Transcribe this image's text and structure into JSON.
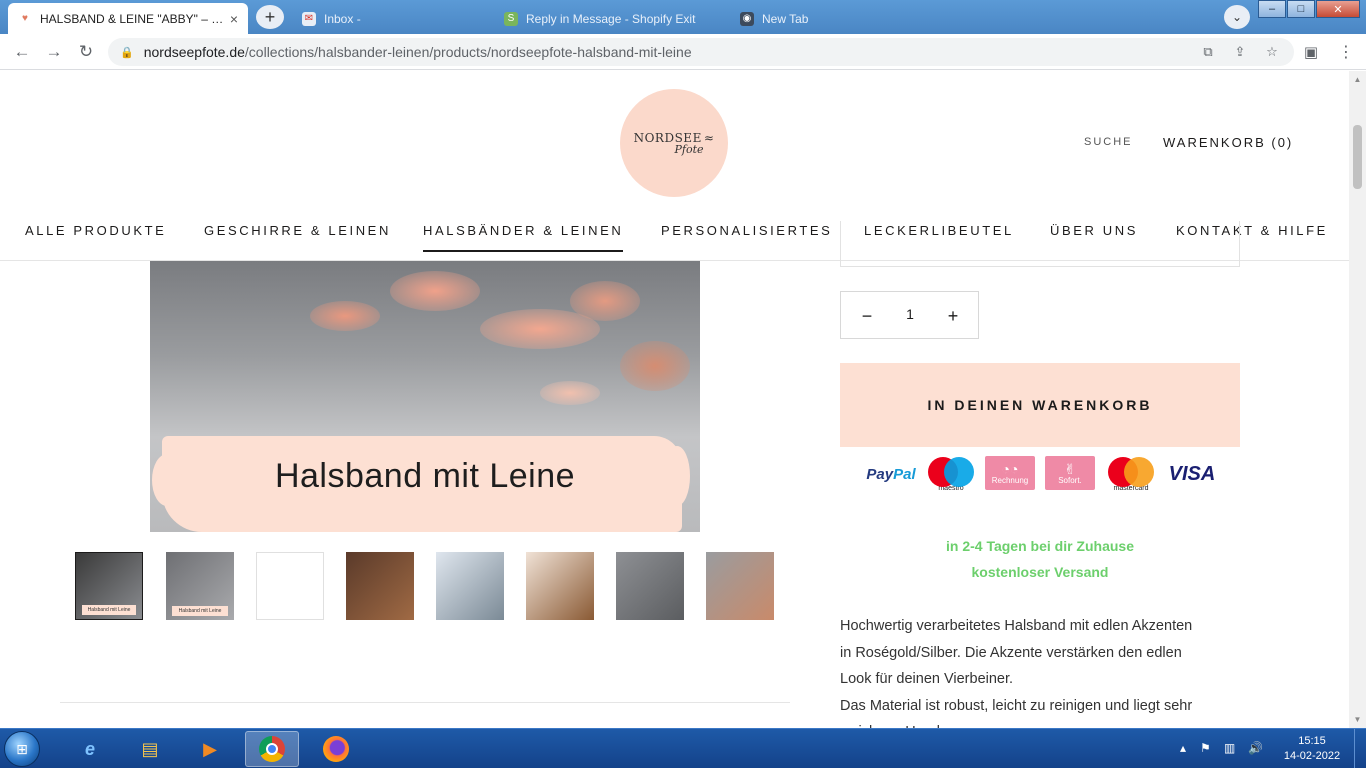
{
  "browser": {
    "tabs": [
      {
        "title": "HALSBAND & LEINE \"ABBY\" – nordseepfote",
        "active": true
      },
      {
        "title": "Inbox - ",
        "active": false
      },
      {
        "title": "Reply in Message - Shopify Exit",
        "active": false
      },
      {
        "title": "New Tab",
        "active": false
      }
    ],
    "close_glyph": "×",
    "newtab_glyph": "+",
    "url_host": "nordseepfote.de",
    "url_path": "/collections/halsbander-leinen/products/nordseepfote-halsband-mit-leine",
    "window_buttons": {
      "minimize": "–",
      "maximize": "□",
      "close": "✕"
    }
  },
  "shop": {
    "logo_top": "NORDSEE",
    "logo_script": "Pfote",
    "header": {
      "search": "SUCHE",
      "cart": "WARENKORB (0)"
    },
    "nav": [
      "ALLE PRODUKTE",
      "GESCHIRRE & LEINEN",
      "HALSBÄNDER & LEINEN",
      "PERSONALISIERTES",
      "LECKERLIBEUTEL",
      "ÜBER UNS",
      "KONTAKT & HILFE"
    ],
    "active_nav_index": 2,
    "image_banner": "Halsband mit Leine",
    "thumbnails": [
      {
        "label": "Halsband mit Leine",
        "colors": [
          "#3a3a3a",
          "#8a8c90"
        ]
      },
      {
        "label": "Halsband mit Leine",
        "colors": [
          "#6e6f73",
          "#a9aaad"
        ]
      },
      {
        "label": "",
        "colors": [
          "#ffffff",
          "#ffffff"
        ]
      },
      {
        "label": "",
        "colors": [
          "#5a3a2a",
          "#a06a44"
        ]
      },
      {
        "label": "",
        "colors": [
          "#dfe6ee",
          "#7b8a96"
        ]
      },
      {
        "label": "",
        "colors": [
          "#f0e2d6",
          "#8a5a34"
        ]
      },
      {
        "label": "",
        "colors": [
          "#8e9094",
          "#5b5d60"
        ]
      },
      {
        "label": "",
        "colors": [
          "#9a9c9f",
          "#c98a6a"
        ]
      }
    ],
    "quantity": {
      "value": "1",
      "minus": "−",
      "plus": "+"
    },
    "add_to_cart": "IN DEINEN WARENKORB",
    "payments": {
      "paypal": "PayPal",
      "maestro": "maestro",
      "rechnung": "Rechnung",
      "sofort": "Sofort.",
      "mastercard": "mastercard",
      "visa": "VISA"
    },
    "shipping": [
      "in 2-4 Tagen bei dir Zuhause",
      "kostenloser Versand"
    ],
    "description": [
      "Hochwertig verarbeitetes Halsband mit edlen Akzenten",
      "in Roségold/Silber. Die Akzente verstärken den edlen",
      "Look für deinen Vierbeiner.",
      "Das Material ist robust, leicht zu reinigen und liegt sehr",
      "weich am Hund an."
    ]
  },
  "taskbar": {
    "time": "15:15",
    "date": "14-02-2022"
  },
  "colors": {
    "accent_peach": "#fde0d3",
    "shipping_green": "#6ccf6c",
    "taskbar_blue": "#1e5aa8"
  }
}
